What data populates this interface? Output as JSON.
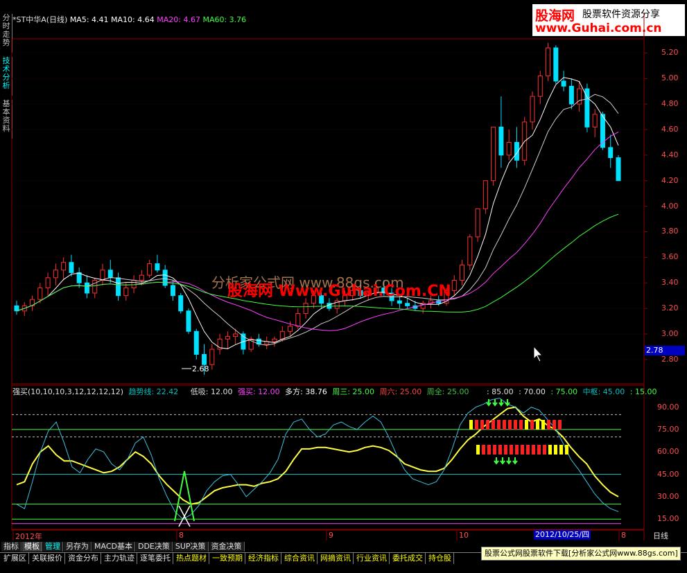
{
  "side_tabs": [
    "分时走势",
    "技术分析",
    "基本资料"
  ],
  "brand": {
    "logo": "股海网",
    "slogan": "股票软件资源分享",
    "url": "www.Guhai.com.cn"
  },
  "main": {
    "title": "*ST中华A(日线)",
    "ma5": "MA5: 4.41",
    "ma10": "MA10: 4.64",
    "ma20": "MA20: 4.67",
    "ma60": "MA60: 3.76",
    "low_label": "2.68",
    "current_price": "2.78"
  },
  "watermarks": [
    "分析家公式网 www.88gs.com",
    "股海网 Www.Guhai.Com.CN"
  ],
  "osc": {
    "name": "强买(10,10,10,3,12,12,12,12)",
    "trend": "趋势线: 22.42",
    "dixi": "低吸: 12.00",
    "qiangmai": "强买: 12.00",
    "duofang": "多方: 38.76",
    "zhousan": "周三: 25.00",
    "zhouliu": "周六: 25.00",
    "zhouquan": "周全: 25.00",
    "l85": ": 85.00",
    "l70": ": 70.00",
    "l75": ": 75.00",
    "zhongshu": "中枢: 45.00",
    "l15": ": 15.00"
  },
  "axes": {
    "price_ticks": [
      "5.20",
      "5.00",
      "4.80",
      "4.60",
      "4.40",
      "4.20",
      "4.00",
      "3.80",
      "3.60",
      "3.40",
      "3.20",
      "3.00",
      "2.80"
    ],
    "osc_ticks": [
      "90.00",
      "75.00",
      "60.00",
      "45.00",
      "30.00",
      "15.00"
    ]
  },
  "xaxis": {
    "labels": [
      "2012年",
      "8",
      "9",
      "10",
      "8"
    ],
    "cursor_date": "2012/10/25/四",
    "period": "日线"
  },
  "tabs": [
    "指标",
    "模板",
    "管理",
    "另存为",
    "MACD基本",
    "DDE决策",
    "SUP决策",
    "资金决策"
  ],
  "footer": {
    "tabs": [
      "扩展区",
      "关联报价",
      "资金分布",
      "主力轨迹",
      "逐笔委托",
      "热点题材",
      "一致预期",
      "经济指标",
      "综合资讯",
      "网摘资讯",
      "行业资讯",
      "委托成交",
      "持仓股"
    ],
    "banner": "股票公式网股票软件下载[分析家公式网www.88gs.com]"
  },
  "colors": {
    "up": "#ff3030",
    "down": "#00e0ff",
    "ma5": "#ffffff",
    "ma10": "#ffffff",
    "ma20": "#ff40ff",
    "ma60": "#40ff40",
    "osc_trend": "#ffff40",
    "osc_raw": "#40c0e0"
  },
  "chart_data": [
    {
      "type": "candlestick",
      "title": "*ST中华A(日线)",
      "ylim": [
        2.62,
        5.3
      ],
      "ohlc": [
        [
          3.22,
          3.26,
          3.15,
          3.18
        ],
        [
          3.18,
          3.25,
          3.14,
          3.22
        ],
        [
          3.22,
          3.3,
          3.18,
          3.27
        ],
        [
          3.27,
          3.4,
          3.24,
          3.36
        ],
        [
          3.36,
          3.48,
          3.3,
          3.44
        ],
        [
          3.44,
          3.55,
          3.38,
          3.5
        ],
        [
          3.5,
          3.6,
          3.42,
          3.56
        ],
        [
          3.56,
          3.62,
          3.45,
          3.48
        ],
        [
          3.48,
          3.52,
          3.36,
          3.4
        ],
        [
          3.4,
          3.46,
          3.28,
          3.32
        ],
        [
          3.32,
          3.44,
          3.28,
          3.42
        ],
        [
          3.42,
          3.55,
          3.38,
          3.5
        ],
        [
          3.5,
          3.58,
          3.4,
          3.44
        ],
        [
          3.44,
          3.48,
          3.26,
          3.3
        ],
        [
          3.3,
          3.4,
          3.26,
          3.36
        ],
        [
          3.36,
          3.46,
          3.32,
          3.42
        ],
        [
          3.42,
          3.5,
          3.38,
          3.46
        ],
        [
          3.46,
          3.58,
          3.44,
          3.55
        ],
        [
          3.55,
          3.62,
          3.48,
          3.5
        ],
        [
          3.5,
          3.54,
          3.36,
          3.38
        ],
        [
          3.38,
          3.42,
          3.26,
          3.3
        ],
        [
          3.3,
          3.32,
          3.16,
          3.18
        ],
        [
          3.18,
          3.2,
          3.0,
          3.02
        ],
        [
          3.02,
          3.04,
          2.8,
          2.84
        ],
        [
          2.84,
          2.92,
          2.68,
          2.76
        ],
        [
          2.76,
          2.92,
          2.72,
          2.88
        ],
        [
          2.88,
          3.0,
          2.84,
          2.96
        ],
        [
          2.96,
          3.02,
          2.88,
          2.98
        ],
        [
          2.98,
          3.04,
          2.92,
          3.0
        ],
        [
          3.0,
          3.02,
          2.84,
          2.88
        ],
        [
          2.88,
          2.98,
          2.86,
          2.96
        ],
        [
          2.96,
          3.0,
          2.9,
          2.92
        ],
        [
          2.92,
          2.98,
          2.88,
          2.94
        ],
        [
          2.94,
          2.98,
          2.9,
          2.96
        ],
        [
          2.96,
          3.06,
          2.94,
          3.02
        ],
        [
          3.02,
          3.1,
          2.98,
          3.06
        ],
        [
          3.06,
          3.2,
          3.04,
          3.16
        ],
        [
          3.16,
          3.28,
          3.12,
          3.24
        ],
        [
          3.24,
          3.34,
          3.2,
          3.3
        ],
        [
          3.3,
          3.36,
          3.2,
          3.24
        ],
        [
          3.24,
          3.28,
          3.18,
          3.2
        ],
        [
          3.2,
          3.28,
          3.16,
          3.26
        ],
        [
          3.26,
          3.34,
          3.22,
          3.3
        ],
        [
          3.3,
          3.38,
          3.26,
          3.34
        ],
        [
          3.34,
          3.4,
          3.28,
          3.3
        ],
        [
          3.3,
          3.34,
          3.26,
          3.32
        ],
        [
          3.32,
          3.4,
          3.3,
          3.36
        ],
        [
          3.36,
          3.42,
          3.3,
          3.32
        ],
        [
          3.32,
          3.36,
          3.22,
          3.26
        ],
        [
          3.26,
          3.3,
          3.2,
          3.24
        ],
        [
          3.24,
          3.28,
          3.2,
          3.22
        ],
        [
          3.22,
          3.26,
          3.18,
          3.2
        ],
        [
          3.2,
          3.26,
          3.16,
          3.24
        ],
        [
          3.24,
          3.3,
          3.2,
          3.26
        ],
        [
          3.26,
          3.3,
          3.22,
          3.24
        ],
        [
          3.24,
          3.36,
          3.22,
          3.34
        ],
        [
          3.34,
          3.46,
          3.3,
          3.42
        ],
        [
          3.42,
          3.58,
          3.38,
          3.54
        ],
        [
          3.54,
          3.78,
          3.5,
          3.76
        ],
        [
          3.76,
          3.98,
          3.72,
          3.98
        ],
        [
          3.98,
          4.2,
          3.94,
          4.2
        ],
        [
          4.2,
          4.62,
          4.16,
          4.62
        ],
        [
          4.62,
          4.86,
          4.3,
          4.4
        ],
        [
          4.4,
          4.6,
          4.36,
          4.5
        ],
        [
          4.5,
          4.62,
          4.3,
          4.36
        ],
        [
          4.36,
          4.7,
          4.32,
          4.66
        ],
        [
          4.66,
          4.9,
          4.6,
          4.86
        ],
        [
          4.86,
          5.06,
          4.8,
          5.02
        ],
        [
          5.02,
          5.28,
          4.98,
          5.24
        ],
        [
          5.24,
          5.26,
          4.96,
          4.98
        ],
        [
          4.98,
          5.06,
          4.9,
          4.94
        ],
        [
          4.94,
          5.0,
          4.76,
          4.8
        ],
        [
          4.8,
          4.98,
          4.74,
          4.92
        ],
        [
          4.92,
          4.96,
          4.58,
          4.62
        ],
        [
          4.62,
          4.76,
          4.54,
          4.72
        ],
        [
          4.72,
          4.74,
          4.44,
          4.46
        ],
        [
          4.46,
          4.56,
          4.3,
          4.38
        ],
        [
          4.38,
          4.4,
          4.2,
          4.2
        ]
      ]
    },
    {
      "type": "line",
      "title": "强买(10,10,10,3,12,12,12,12)",
      "ylim": [
        10,
        100
      ],
      "series": [
        {
          "name": "趋势线",
          "values": [
            38,
            40,
            52,
            60,
            64,
            58,
            54,
            54,
            52,
            50,
            48,
            46,
            47,
            50,
            55,
            60,
            57,
            52,
            44,
            38,
            33,
            28,
            25,
            26,
            30,
            34,
            36,
            37,
            38,
            38,
            37,
            39,
            40,
            42,
            47,
            55,
            62,
            62,
            63,
            63,
            62,
            61,
            60,
            61,
            63,
            64,
            63,
            61,
            57,
            52,
            50,
            48,
            47,
            47,
            49,
            55,
            62,
            68,
            72,
            77,
            81,
            85,
            89,
            90,
            84,
            80,
            82,
            78,
            75,
            70,
            63,
            57,
            52,
            44,
            38,
            33,
            30
          ]
        },
        {
          "name": "多方",
          "values": [
            25,
            22,
            40,
            60,
            74,
            80,
            66,
            50,
            46,
            55,
            62,
            60,
            52,
            48,
            55,
            66,
            70,
            58,
            42,
            30,
            20,
            15,
            18,
            24,
            34,
            40,
            44,
            45,
            38,
            30,
            35,
            40,
            46,
            55,
            72,
            80,
            82,
            75,
            70,
            72,
            78,
            80,
            77,
            75,
            80,
            84,
            80,
            70,
            58,
            48,
            42,
            40,
            38,
            40,
            48,
            62,
            78,
            86,
            90,
            92,
            95,
            96,
            92,
            90,
            86,
            90,
            88,
            82,
            76,
            66,
            55,
            48,
            40,
            32,
            26,
            22,
            20
          ]
        }
      ]
    }
  ]
}
